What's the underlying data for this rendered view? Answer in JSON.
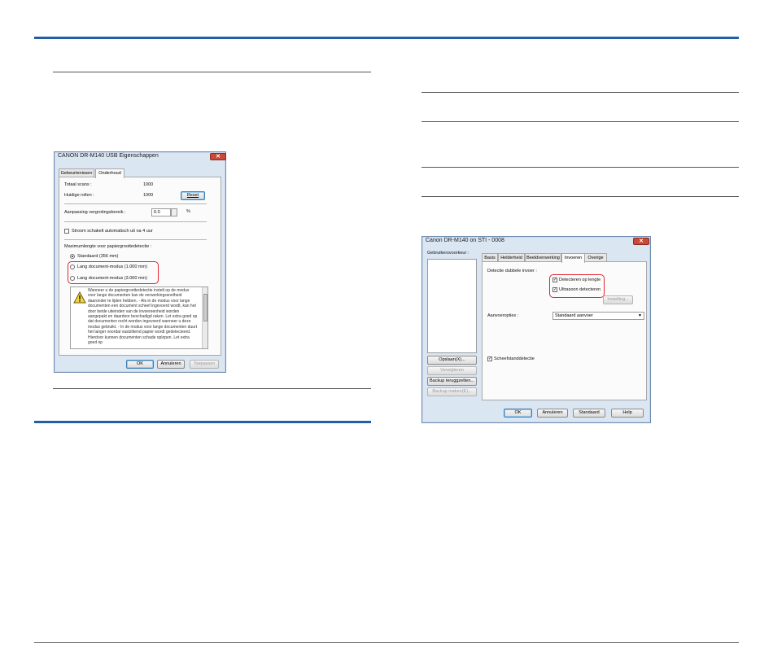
{
  "left_dialog": {
    "title": "CANON DR-M140 USB Eigenschappen",
    "close_glyph": "✕",
    "tabs": [
      "Gebeurtenissen",
      "Onderhoud"
    ],
    "total_scans_label": "Totaal scans :",
    "total_scans_value": "1000",
    "current_rolls_label": "Huidige rollen :",
    "current_rolls_value": "1000",
    "reset_label": "Reset",
    "feed_adjust_label": "Aanpassing vergrotingsbereik :",
    "feed_adjust_value": "0.0",
    "feed_adjust_unit": "%",
    "power_off_label": "Stroom schakelt automatisch uit na 4 uur",
    "max_length_label": "Maximumlengte voor papiergroottedetectie :",
    "radio_standard": "Standaard (356 mm)",
    "radio_long1": "Lang document-modus (1.000 mm)",
    "radio_long3": "Lang document-modus (3.000 mm)",
    "warning_text": "Wanneer u de papiergroottedetectie instelt op de modus voor lange documenten kan de verwerkingssnelheid daaronder te lijden hebben. - Als in de modus voor lange documenten een document scheef ingevoerd wordt, kan het door beide uiteinden van de invoereenheid worden aangepakt en daardoor beschadigd raken. Let extra goed op dat documenten recht worden ingevoerd wanneer u deze modus gebruikt. - In de modus voor lange documenten duurt het langer voordat vastzittend papier wordt gedetecteerd. Hierdoor kunnen documenten schade oplopen. Let extra goed op",
    "ok_label": "OK",
    "cancel_label": "Annuleren",
    "apply_label": "Toepassen"
  },
  "right_dialog": {
    "title": "Canon DR-M140 on STI - 0008",
    "close_glyph": "✕",
    "user_prefs_label": "Gebruikersvoorkeur :",
    "tabs": [
      "Basis",
      "Helderheid",
      "Beeldverwerking",
      "Invoeren",
      "Overige"
    ],
    "double_feed_label": "Detectie dubbele invoer :",
    "detect_length_label": "Detecteren op lengte",
    "detect_ultrasonic_label": "Ultrasoon detecteren",
    "settings_label": "Instelling...",
    "feed_options_label": "Aanvoeropties :",
    "feed_options_value": "Standaard aanvoer",
    "skew_label": "Scheefstanddetectie",
    "save_label": "Opslaan(X)...",
    "delete_label": "Verwijderen",
    "restore_label": "Backup teruggzetten...",
    "backup_label": "Backup maken(E)...",
    "ok_label": "OK",
    "cancel_label": "Annuleren",
    "default_label": "Standaard",
    "help_label": "Help"
  },
  "colors": {
    "accent_bar": "#1f5fa8",
    "highlight": "#e0262e",
    "close_button": "#c94a3a"
  }
}
